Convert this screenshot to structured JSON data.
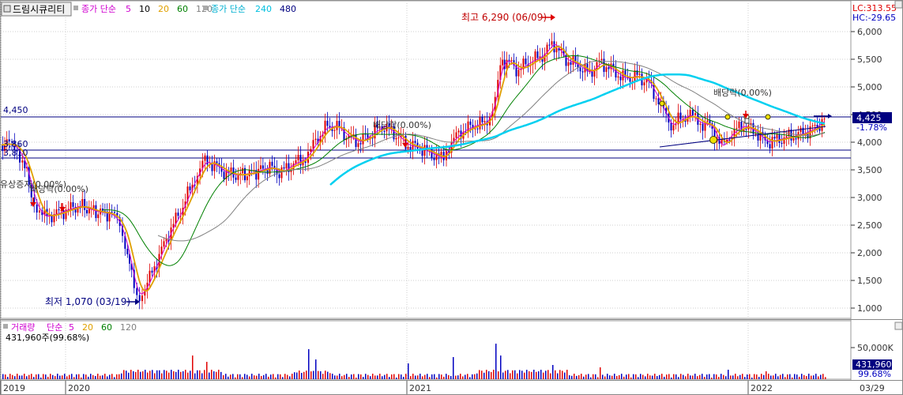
{
  "header": {
    "stock_name": "드림시큐리티",
    "ma_label": "종가 단순",
    "ma_periods": [
      "5",
      "10",
      "20",
      "60",
      "120"
    ],
    "ma_colors": [
      "#d000d0",
      "#000000",
      "#e0a000",
      "#008000",
      "#808080"
    ],
    "ma_long_label": "종가 단순",
    "ma_long_periods": [
      "240",
      "480"
    ],
    "ma_long_colors": [
      "#00c0e0",
      "#000080"
    ],
    "lc_label": "LC:313.55",
    "hc_label": "HC:-29.65"
  },
  "price_axis": {
    "ticks": [
      "6,000",
      "5,500",
      "5,000",
      "4,500",
      "4,000",
      "3,500",
      "3,000",
      "2,500",
      "2,000",
      "1,500",
      "1,000"
    ],
    "current_price": "4,425",
    "current_change": "-1.78%"
  },
  "annotations": {
    "high_label": "최고 6,290 (06/09)",
    "low_label": "최저 1,070 (03/19)",
    "level_4450": "4,450",
    "level_3860": "3,860",
    "level_3810": "3,810",
    "dividend_1": "배당락(0.00%)",
    "dividend_2": "배당락(0.00%)",
    "dividend_3": "배당락(0.00%)",
    "rights_issue": "유상증자(0.00%)"
  },
  "volume": {
    "title": "거래량",
    "ma_label": "단순",
    "ma_periods": [
      "5",
      "20",
      "60",
      "120"
    ],
    "ma_colors": [
      "#d000d0",
      "#e0a000",
      "#008000",
      "#808080"
    ],
    "current": "431,960주(99.68%)",
    "axis_tick": "50,000K",
    "current_value": "431,960",
    "current_pct": "99.68%"
  },
  "time_axis": {
    "labels": [
      "2019",
      "2020",
      "2021",
      "2022"
    ],
    "last_date": "03/29"
  },
  "colors": {
    "up": "#e00000",
    "down": "#0000c0",
    "ma5": "#d000d0",
    "ma20": "#e0a000",
    "ma60": "#008000",
    "ma120": "#808080",
    "ma240": "#00d0f0",
    "level_line": "#000080"
  }
}
